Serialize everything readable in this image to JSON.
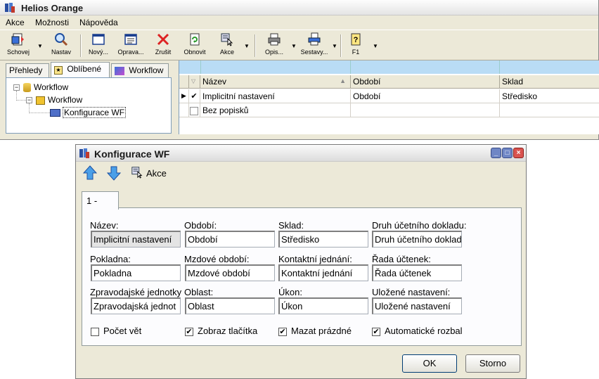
{
  "main": {
    "title": "Helios Orange",
    "menu": [
      "Akce",
      "Možnosti",
      "Nápověda"
    ],
    "toolbar": {
      "schovej": "Schovej",
      "nastav": "Nastav",
      "novy": "Nový...",
      "oprava": "Oprava...",
      "zrusit": "Zrušit",
      "obnovit": "Obnovit",
      "akce": "Akce",
      "opis": "Opis...",
      "sestavy": "Sestavy...",
      "f1": "F1"
    },
    "left_tabs": [
      "Přehledy",
      "Oblíbené",
      "Workflow"
    ],
    "tree": [
      "Workflow",
      "Workflow",
      "Konfigurace WF"
    ],
    "grid": {
      "columns": [
        "Název",
        "Období",
        "Sklad"
      ],
      "rows": [
        {
          "checked": "✔",
          "name": "Implicitní nastavení",
          "obdobi": "Období",
          "sklad": "Středisko"
        },
        {
          "checked": "",
          "name": "Bez popisků",
          "obdobi": "",
          "sklad": ""
        }
      ]
    }
  },
  "dialog": {
    "title": "Konfigurace WF",
    "toolbar_akce": "Akce",
    "tab": "1 -",
    "fields": [
      {
        "label": "Název:",
        "value": "Implicitní nastavení"
      },
      {
        "label": "Období:",
        "value": "Období"
      },
      {
        "label": "Sklad:",
        "value": "Středisko"
      },
      {
        "label": "Druh účetního dokladu:",
        "value": "Druh účetního doklad"
      },
      {
        "label": "Pokladna:",
        "value": "Pokladna"
      },
      {
        "label": "Mzdové období:",
        "value": "Mzdové období"
      },
      {
        "label": "Kontaktní jednání:",
        "value": "Kontaktní jednání"
      },
      {
        "label": "Řada účtenek:",
        "value": "Řada účtenek"
      },
      {
        "label": "Zpravodajské jednotky",
        "value": "Zpravodajská jednot"
      },
      {
        "label": "Oblast:",
        "value": "Oblast"
      },
      {
        "label": "Úkon:",
        "value": "Úkon"
      },
      {
        "label": "Uložené nastavení:",
        "value": "Uložené nastavení"
      }
    ],
    "checkboxes": [
      {
        "label": "Počet vět",
        "mark": ""
      },
      {
        "label": "Zobraz tlačítka",
        "mark": "✔"
      },
      {
        "label": "Mazat prázdné",
        "mark": "✔"
      },
      {
        "label": "Automatické rozbal",
        "mark": "✔"
      }
    ],
    "ok": "OK",
    "cancel": "Storno"
  }
}
